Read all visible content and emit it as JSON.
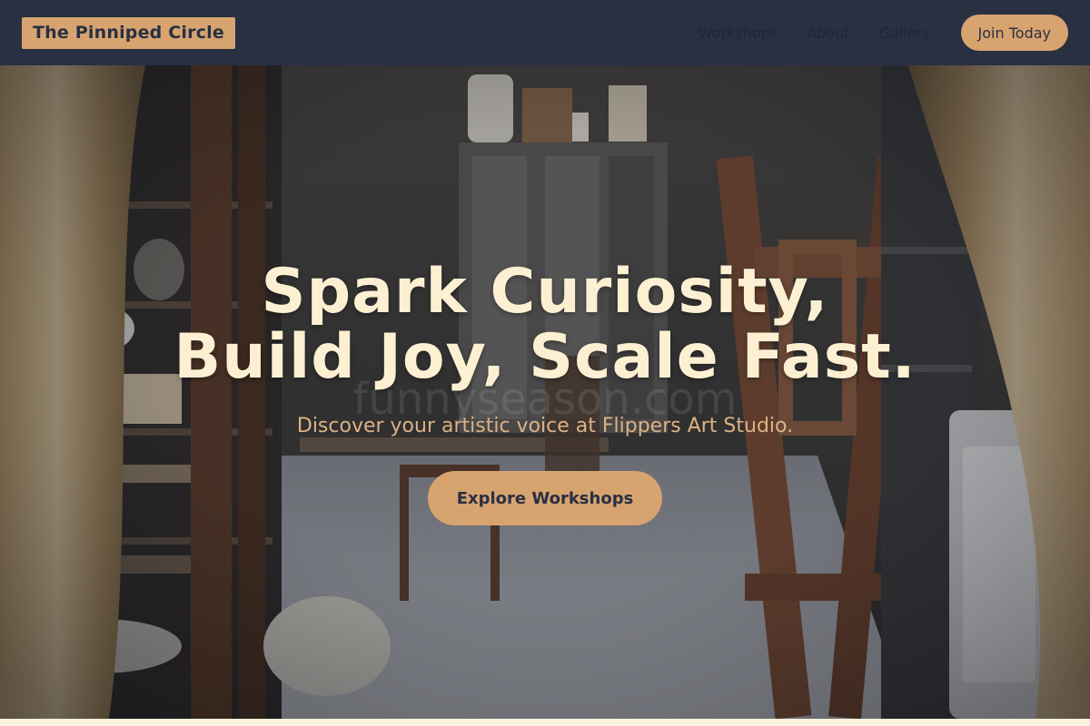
{
  "header": {
    "brand": "The Pinniped Circle",
    "nav": [
      "Workshops",
      "About",
      "Gallery"
    ],
    "join_label": "Join Today"
  },
  "hero": {
    "title_line1": "Spark Curiosity,",
    "title_line2": "Build Joy, Scale Fast.",
    "subtitle": "Discover your artistic voice at Flippers Art Studio.",
    "cta_label": "Explore Workshops",
    "watermark": "funnyseason.com"
  },
  "colors": {
    "header_bg": "#283042",
    "accent": "#d7a36f",
    "title_text": "#fdf0d2",
    "subtitle_text": "#ddb184",
    "page_bg": "#fbf3dc"
  }
}
